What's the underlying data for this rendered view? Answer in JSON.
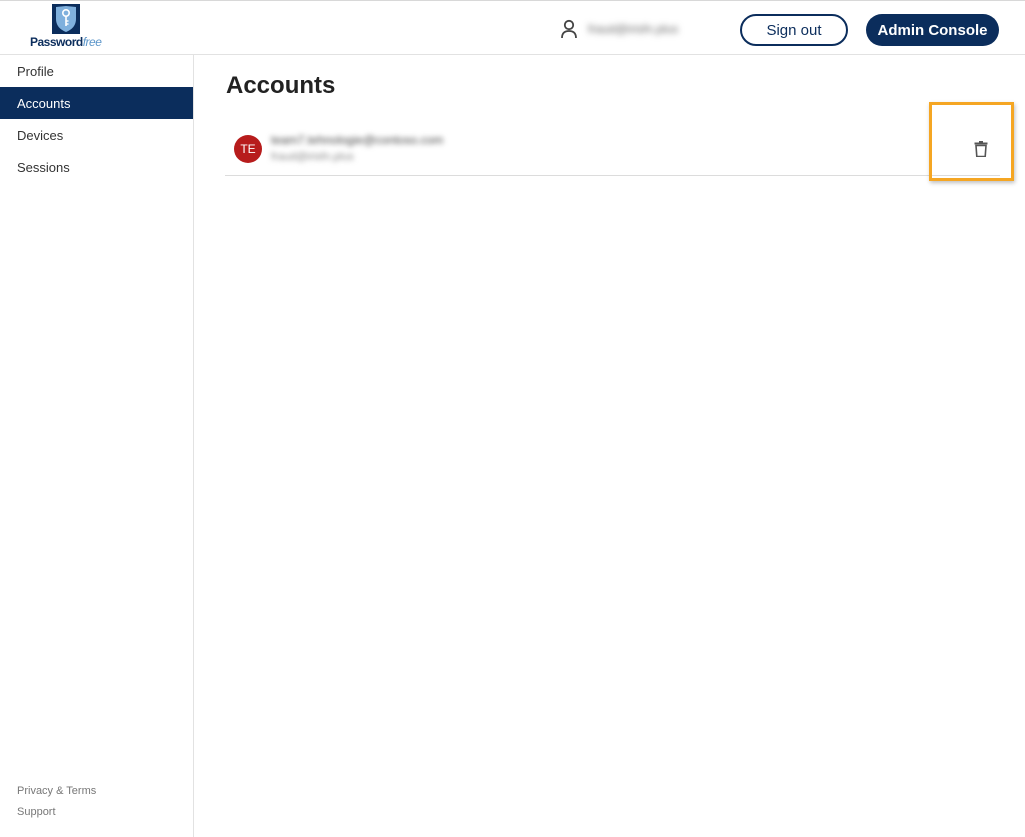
{
  "brand": {
    "logo_text_main": "Password",
    "logo_text_accent": "free",
    "primary_color": "#0b2d5c",
    "accent_color": "#5b95c9"
  },
  "header": {
    "user_icon": "person-icon",
    "user_email": "fraud@irisfn.plus",
    "sign_out_label": "Sign out",
    "admin_console_label": "Admin Console"
  },
  "sidebar": {
    "items": [
      {
        "label": "Profile",
        "active": false
      },
      {
        "label": "Accounts",
        "active": true
      },
      {
        "label": "Devices",
        "active": false
      },
      {
        "label": "Sessions",
        "active": false
      }
    ],
    "footer": {
      "privacy_label": "Privacy & Terms",
      "support_label": "Support"
    }
  },
  "main": {
    "title": "Accounts",
    "accounts": [
      {
        "initials": "TE",
        "avatar_color": "#b71c1c",
        "primary": "team7.tehnologie@contoso.com",
        "secondary": "fraud@irisfn.plus",
        "action_icon": "trash-icon"
      }
    ]
  },
  "annotation": {
    "highlight_color": "#f5a623"
  }
}
